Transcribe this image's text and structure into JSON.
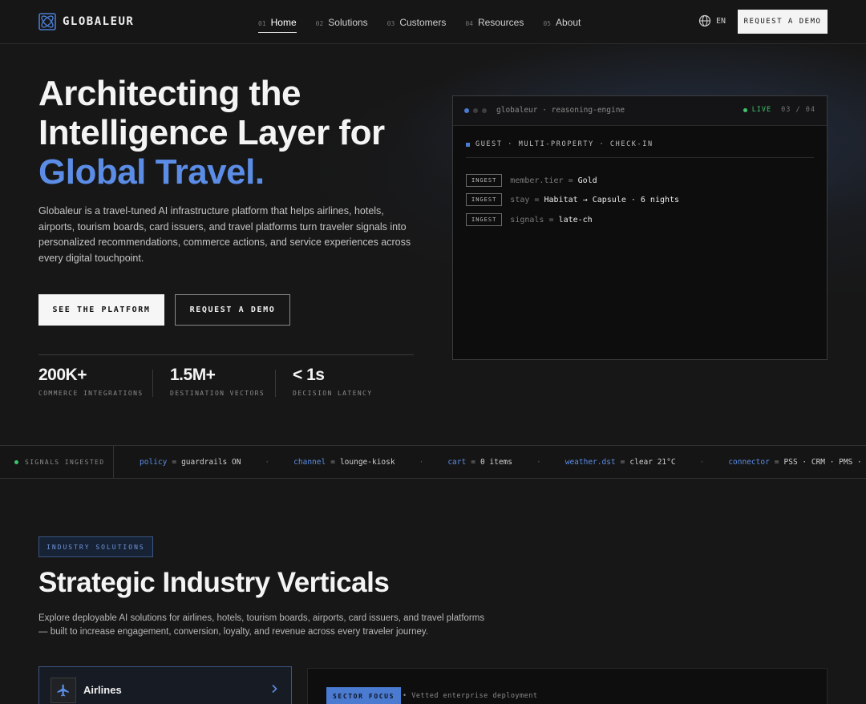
{
  "nav": {
    "logo_text": "GLOBALEUR",
    "links": [
      {
        "num": "01",
        "label": "Home"
      },
      {
        "num": "02",
        "label": "Solutions"
      },
      {
        "num": "03",
        "label": "Customers"
      },
      {
        "num": "04",
        "label": "Resources"
      },
      {
        "num": "05",
        "label": "About"
      }
    ],
    "lang": "EN",
    "cta": "REQUEST A DEMO"
  },
  "hero": {
    "title_line1": "Architecting the",
    "title_line2": "Intelligence Layer for",
    "title_accent": "Global Travel.",
    "description": "Globaleur is a travel-tuned AI infrastructure platform that helps airlines, hotels, airports, tourism boards, card issuers, and travel platforms turn traveler signals into personalized recommendations, commerce actions, and service experiences across every digital touchpoint.",
    "primary_button": "SEE THE PLATFORM",
    "secondary_button": "REQUEST A DEMO",
    "stats": [
      {
        "value": "200K+",
        "label": "COMMERCE INTEGRATIONS"
      },
      {
        "value": "1.5M+",
        "label": "DESTINATION VECTORS"
      },
      {
        "value": "< 1s",
        "label": "DECISION LATENCY"
      }
    ]
  },
  "terminal": {
    "title": "globaleur · reasoning-engine",
    "live": "LIVE",
    "page": "03 / 04",
    "section": "GUEST · MULTI-PROPERTY · CHECK-IN",
    "rows": [
      {
        "tag": "INGEST",
        "key": "member.tier",
        "eq": "=",
        "value": "Gold"
      },
      {
        "tag": "INGEST",
        "key": "stay",
        "eq": "=",
        "value": "Habitat → Capsule · 6 nights"
      },
      {
        "tag": "INGEST",
        "key": "signals",
        "eq": "=",
        "value": "late-ch"
      }
    ]
  },
  "ticker": {
    "label": "SIGNALS INGESTED",
    "items": [
      {
        "key": "policy",
        "value": "guardrails ON"
      },
      {
        "key": "channel",
        "value": "lounge-kiosk"
      },
      {
        "key": "cart",
        "value": "0 items"
      },
      {
        "key": "weather.dst",
        "value": "clear 21°C"
      },
      {
        "key": "connector",
        "value": "PSS · CRM · PMS · DM"
      }
    ],
    "separator": "·",
    "eq": "="
  },
  "industry": {
    "badge": "INDUSTRY SOLUTIONS",
    "title": "Strategic Industry Verticals",
    "description": "Explore deployable AI solutions for airlines, hotels, tourism boards, airports, card issuers, and travel platforms — built to increase engagement, conversion, loyalty, and revenue across every traveler journey.",
    "verticals": [
      {
        "label": "Airlines",
        "icon": "airplane-icon"
      }
    ],
    "focus_badge": "SECTOR FOCUS",
    "focus_text": "• Vetted enterprise deployment"
  },
  "colors": {
    "accent": "#5b8de6",
    "live": "#3ec46d",
    "background": "#171717"
  }
}
